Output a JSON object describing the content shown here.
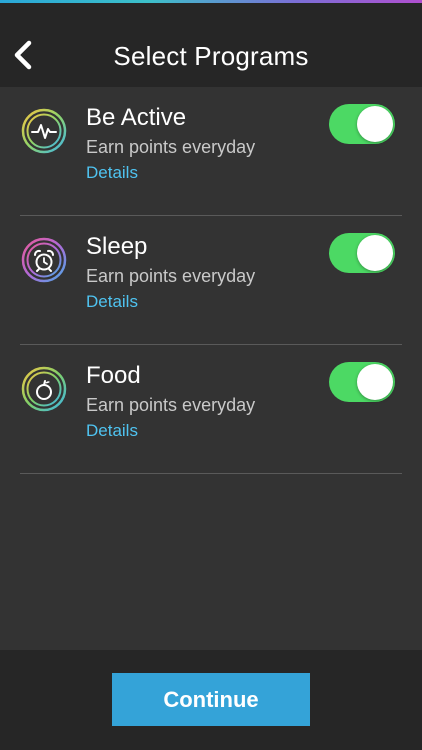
{
  "header": {
    "title": "Select Programs",
    "back_icon": "chevron-left-icon"
  },
  "programs": [
    {
      "title": "Be Active",
      "subtitle": "Earn points everyday",
      "link": "Details",
      "icon": "heartbeat-icon",
      "enabled": true
    },
    {
      "title": "Sleep",
      "subtitle": "Earn points everyday",
      "link": "Details",
      "icon": "alarm-clock-icon",
      "enabled": true
    },
    {
      "title": "Food",
      "subtitle": "Earn points everyday",
      "link": "Details",
      "icon": "apple-icon",
      "enabled": true
    }
  ],
  "footer": {
    "continue_label": "Continue"
  },
  "colors": {
    "background": "#333333",
    "bar": "#262626",
    "toggle_on": "#4cd964",
    "link": "#4fc3f0",
    "button": "#34a3d8"
  }
}
